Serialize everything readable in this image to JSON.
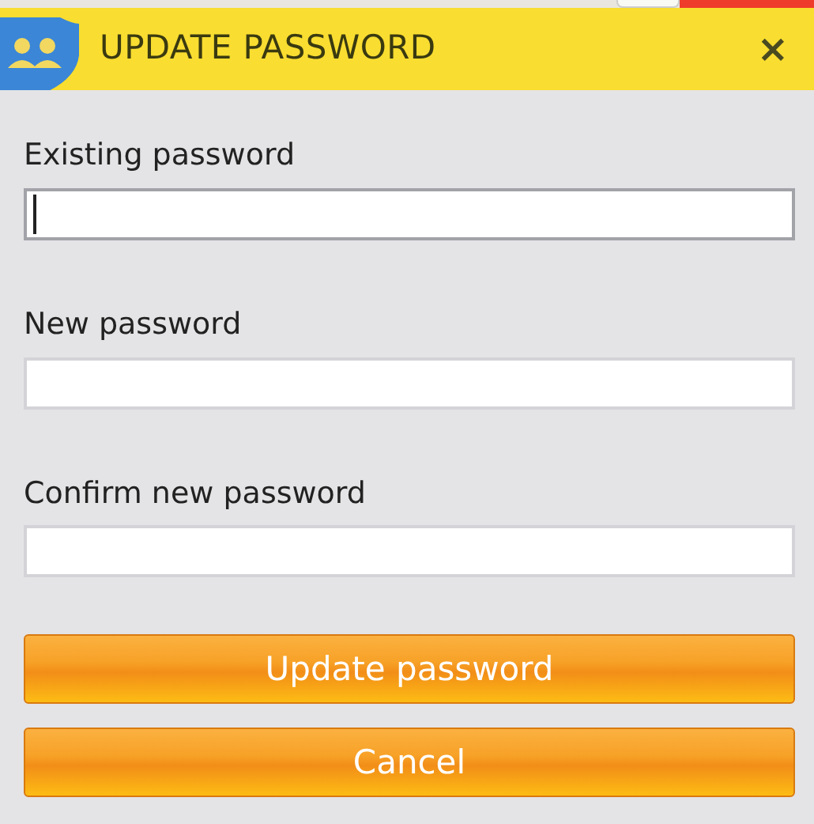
{
  "window": {
    "title": "UPDATE PASSWORD",
    "close": "×"
  },
  "fields": [
    {
      "label": "Existing password",
      "focused": true
    },
    {
      "label": "New password",
      "focused": false
    },
    {
      "label": "Confirm new password",
      "focused": false
    }
  ],
  "buttons": [
    "Update password",
    "Cancel"
  ]
}
